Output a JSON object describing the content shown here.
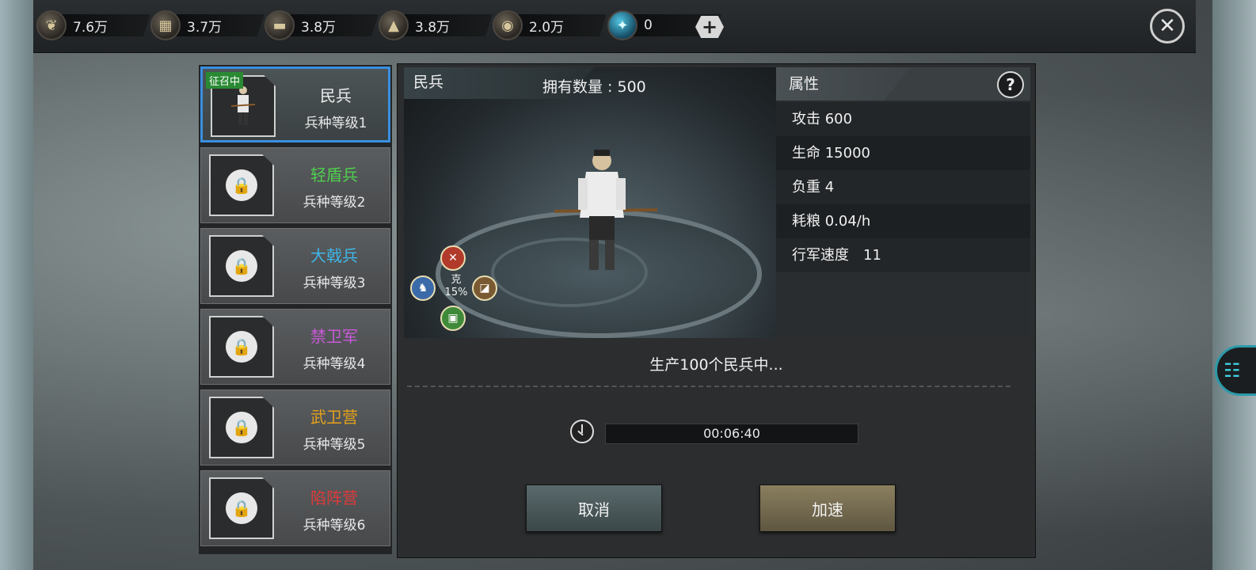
{
  "resources": [
    {
      "icon": "grain-icon",
      "glyph": "❦",
      "value": "7.6万"
    },
    {
      "icon": "wood-icon",
      "glyph": "▦",
      "value": "3.7万"
    },
    {
      "icon": "iron-icon",
      "glyph": "▬",
      "value": "3.8万"
    },
    {
      "icon": "stone-icon",
      "glyph": "▲",
      "value": "3.8万"
    },
    {
      "icon": "coin-icon",
      "glyph": "◉",
      "value": "2.0万"
    },
    {
      "icon": "gem-icon",
      "glyph": "✦",
      "value": "0"
    }
  ],
  "plus_label": "+",
  "close_label": "✕",
  "units": [
    {
      "name": "民兵",
      "level": "兵种等级1",
      "color": "#f0f0f0",
      "recruiting": true,
      "tag": "征召中"
    },
    {
      "name": "轻盾兵",
      "level": "兵种等级2",
      "color": "#4fd04f"
    },
    {
      "name": "大戟兵",
      "level": "兵种等级3",
      "color": "#3fb6e8"
    },
    {
      "name": "禁卫军",
      "level": "兵种等级4",
      "color": "#c85ad8"
    },
    {
      "name": "武卫营",
      "level": "兵种等级5",
      "color": "#e6a21a"
    },
    {
      "name": "陷阵营",
      "level": "兵种等级6",
      "color": "#e03a3a"
    }
  ],
  "detail": {
    "unit_name": "民兵",
    "owned": "拥有数量 : 500",
    "counter_label": "克",
    "counter_value": "15%",
    "attr_title": "属性",
    "help": "?",
    "attributes": [
      {
        "label": "攻击 600"
      },
      {
        "label": "生命 15000"
      },
      {
        "label": "负重 4"
      },
      {
        "label": "耗粮 0.04/h"
      },
      {
        "label": "行军速度　11"
      }
    ],
    "production": "生产100个民兵中...",
    "timer": "00:06:40",
    "cancel": "取消",
    "speedup": "加速"
  }
}
